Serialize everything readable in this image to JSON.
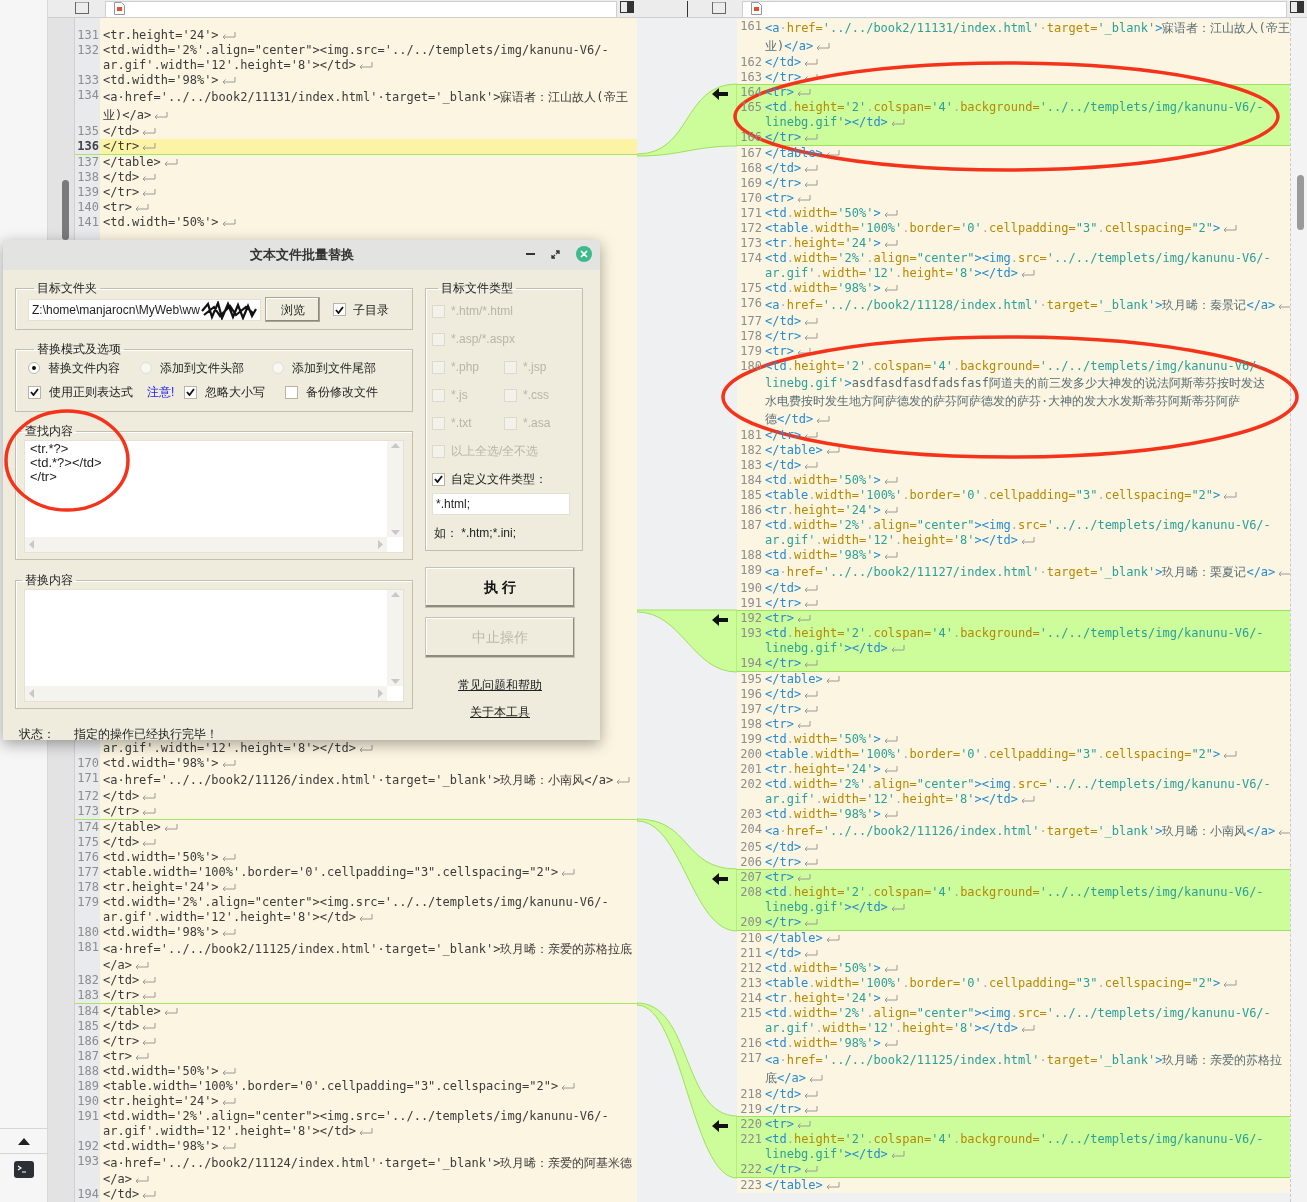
{
  "left_pane": {
    "lines_above_dialog": [
      {
        "number": "131",
        "rows": [
          "<tr.height='24'>"
        ],
        "current": false,
        "chunk_edge": false
      },
      {
        "number": "132",
        "rows": [
          "<td.width='2%'.align=\"center\"><img.src='../../templets/img/kanunu-V6/-",
          "ar.gif'.width='12'.height='8'></td>"
        ],
        "current": false,
        "chunk_edge": false
      },
      {
        "number": "133",
        "rows": [
          "<td.width='98%'>"
        ],
        "current": false,
        "chunk_edge": false
      },
      {
        "number": "134",
        "rows": [
          "<a·href='../../book2/11131/index.html'·target='_blank'>寐语者：江山故人(帝王",
          "业)</a>"
        ],
        "current": false,
        "chunk_edge": false
      },
      {
        "number": "135",
        "rows": [
          "</td>"
        ],
        "current": false,
        "chunk_edge": false
      },
      {
        "number": "136",
        "rows": [
          "</tr>"
        ],
        "current": true,
        "chunk_edge": true
      },
      {
        "number": "137",
        "rows": [
          "</table>"
        ],
        "current": false,
        "chunk_edge": false
      },
      {
        "number": "138",
        "rows": [
          "</td>"
        ],
        "current": false,
        "chunk_edge": false
      },
      {
        "number": "139",
        "rows": [
          "</tr>"
        ],
        "current": false,
        "chunk_edge": false
      },
      {
        "number": "140",
        "rows": [
          "<tr>"
        ],
        "current": false,
        "chunk_edge": false
      },
      {
        "number": "141",
        "rows": [
          "<td.width='50%'>"
        ],
        "current": false,
        "chunk_edge": false
      }
    ],
    "lines_below_dialog": [
      {
        "rows": [
          "ar.gif'.width='12'.height='8'></td>"
        ],
        "current": false,
        "chunk_edge": false
      },
      {
        "number": "170",
        "rows": [
          "<td.width='98%'>"
        ],
        "current": false,
        "chunk_edge": false
      },
      {
        "number": "171",
        "rows": [
          "<a·href='../../book2/11126/index.html'·target='_blank'>玖月晞：小南风</a>"
        ],
        "current": false,
        "chunk_edge": false
      },
      {
        "number": "172",
        "rows": [
          "</td>"
        ],
        "current": false,
        "chunk_edge": false
      },
      {
        "number": "173",
        "rows": [
          "</tr>"
        ],
        "current": false,
        "chunk_edge": true
      },
      {
        "number": "174",
        "rows": [
          "</table>"
        ],
        "current": false,
        "chunk_edge": false
      },
      {
        "number": "175",
        "rows": [
          "</td>"
        ],
        "current": false,
        "chunk_edge": false
      },
      {
        "number": "176",
        "rows": [
          "<td.width='50%'>"
        ],
        "current": false,
        "chunk_edge": false
      },
      {
        "number": "177",
        "rows": [
          "<table.width='100%'.border='0'.cellpadding=\"3\".cellspacing=\"2\">"
        ],
        "current": false,
        "chunk_edge": false
      },
      {
        "number": "178",
        "rows": [
          "<tr.height='24'>"
        ],
        "current": false,
        "chunk_edge": false
      },
      {
        "number": "179",
        "rows": [
          "<td.width='2%'.align=\"center\"><img.src='../../templets/img/kanunu-V6/-",
          "ar.gif'.width='12'.height='8'></td>"
        ],
        "current": false,
        "chunk_edge": false
      },
      {
        "number": "180",
        "rows": [
          "<td.width='98%'>"
        ],
        "current": false,
        "chunk_edge": false
      },
      {
        "number": "181",
        "rows": [
          "<a·href='../../book2/11125/index.html'·target='_blank'>玖月晞：亲爱的苏格拉底",
          "</a>"
        ],
        "current": false,
        "chunk_edge": false
      },
      {
        "number": "182",
        "rows": [
          "</td>"
        ],
        "current": false,
        "chunk_edge": false
      },
      {
        "number": "183",
        "rows": [
          "</tr>"
        ],
        "current": false,
        "chunk_edge": true
      },
      {
        "number": "184",
        "rows": [
          "</table>"
        ],
        "current": false,
        "chunk_edge": false
      },
      {
        "number": "185",
        "rows": [
          "</td>"
        ],
        "current": false,
        "chunk_edge": false
      },
      {
        "number": "186",
        "rows": [
          "</tr>"
        ],
        "current": false,
        "chunk_edge": false
      },
      {
        "number": "187",
        "rows": [
          "<tr>"
        ],
        "current": false,
        "chunk_edge": false
      },
      {
        "number": "188",
        "rows": [
          "<td.width='50%'>"
        ],
        "current": false,
        "chunk_edge": false
      },
      {
        "number": "189",
        "rows": [
          "<table.width='100%'.border='0'.cellpadding=\"3\".cellspacing=\"2\">"
        ],
        "current": false,
        "chunk_edge": false
      },
      {
        "number": "190",
        "rows": [
          "<tr.height='24'>"
        ],
        "current": false,
        "chunk_edge": false
      },
      {
        "number": "191",
        "rows": [
          "<td.width='2%'.align=\"center\"><img.src='../../templets/img/kanunu-V6/-",
          "ar.gif'.width='12'.height='8'></td>"
        ],
        "current": false,
        "chunk_edge": false
      },
      {
        "number": "192",
        "rows": [
          "<td.width='98%'>"
        ],
        "current": false,
        "chunk_edge": false
      },
      {
        "number": "193",
        "rows": [
          "<a·href='../../book2/11124/index.html'·target='_blank'>玖月晞：亲爱的阿基米德",
          "</a>"
        ],
        "current": false,
        "chunk_edge": false
      },
      {
        "number": "194",
        "rows": [
          "</td>"
        ],
        "current": false,
        "chunk_edge": false
      }
    ]
  },
  "right_pane": {
    "lines": [
      {
        "number": "161",
        "rows": [
          "<a·href='../../book2/11131/index.html'·target='_blank'>寐语者：江山故人(帝王",
          "业)</a>"
        ],
        "changed": false
      },
      {
        "number": "162",
        "rows": [
          "</td>"
        ],
        "changed": false
      },
      {
        "number": "163",
        "rows": [
          "</tr>"
        ],
        "changed": false
      },
      {
        "number": "164",
        "rows": [
          "<tr>"
        ],
        "changed": true
      },
      {
        "number": "165",
        "rows": [
          "<td.height='2'.colspan='4'.background='../../templets/img/kanunu-V6/-",
          "linebg.gif'></td>"
        ],
        "changed": true
      },
      {
        "number": "166",
        "rows": [
          "</tr>"
        ],
        "changed": true
      },
      {
        "number": "167",
        "rows": [
          "</table>"
        ],
        "changed": false
      },
      {
        "number": "168",
        "rows": [
          "</td>"
        ],
        "changed": false
      },
      {
        "number": "169",
        "rows": [
          "</tr>"
        ],
        "changed": false
      },
      {
        "number": "170",
        "rows": [
          "<tr>"
        ],
        "changed": false
      },
      {
        "number": "171",
        "rows": [
          "<td.width='50%'>"
        ],
        "changed": false
      },
      {
        "number": "172",
        "rows": [
          "<table.width='100%'.border='0'.cellpadding=\"3\".cellspacing=\"2\">"
        ],
        "changed": false
      },
      {
        "number": "173",
        "rows": [
          "<tr.height='24'>"
        ],
        "changed": false
      },
      {
        "number": "174",
        "rows": [
          "<td.width='2%'.align=\"center\"><img.src='../../templets/img/kanunu-V6/-",
          "ar.gif'.width='12'.height='8'></td>"
        ],
        "changed": false
      },
      {
        "number": "175",
        "rows": [
          "<td.width='98%'>"
        ],
        "changed": false
      },
      {
        "number": "176",
        "rows": [
          "<a·href='../../book2/11128/index.html'·target='_blank'>玖月晞：秦景记</a>"
        ],
        "changed": false
      },
      {
        "number": "177",
        "rows": [
          "</td>"
        ],
        "changed": false
      },
      {
        "number": "178",
        "rows": [
          "</tr>"
        ],
        "changed": false
      },
      {
        "number": "179",
        "rows": [
          "<tr>"
        ],
        "changed": false
      },
      {
        "number": "180",
        "rows": [
          "<td.height='2'.colspan='4'.background='../../templets/img/kanunu-V6/-",
          "linebg.gif'>asdfasdfasdfadsfasf阿道夫的前三发多少大神发的说法阿斯蒂芬按时发达",
          "水电费按时发生地方阿萨德发的萨芬阿萨德发的萨芬·大神的发大水发斯蒂芬阿斯蒂芬阿萨",
          "德</td>"
        ],
        "changed": false
      },
      {
        "number": "181",
        "rows": [
          "</tr>"
        ],
        "changed": false
      },
      {
        "number": "182",
        "rows": [
          "</table>"
        ],
        "changed": false
      },
      {
        "number": "183",
        "rows": [
          "</td>"
        ],
        "changed": false
      },
      {
        "number": "184",
        "rows": [
          "<td.width='50%'>"
        ],
        "changed": false
      },
      {
        "number": "185",
        "rows": [
          "<table.width='100%'.border='0'.cellpadding=\"3\".cellspacing=\"2\">"
        ],
        "changed": false
      },
      {
        "number": "186",
        "rows": [
          "<tr.height='24'>"
        ],
        "changed": false
      },
      {
        "number": "187",
        "rows": [
          "<td.width='2%'.align=\"center\"><img.src='../../templets/img/kanunu-V6/-",
          "ar.gif'.width='12'.height='8'></td>"
        ],
        "changed": false
      },
      {
        "number": "188",
        "rows": [
          "<td.width='98%'>"
        ],
        "changed": false
      },
      {
        "number": "189",
        "rows": [
          "<a·href='../../book2/11127/index.html'·target='_blank'>玖月晞：栗夏记</a>"
        ],
        "changed": false
      },
      {
        "number": "190",
        "rows": [
          "</td>"
        ],
        "changed": false
      },
      {
        "number": "191",
        "rows": [
          "</tr>"
        ],
        "changed": false
      },
      {
        "number": "192",
        "rows": [
          "<tr>"
        ],
        "changed": true
      },
      {
        "number": "193",
        "rows": [
          "<td.height='2'.colspan='4'.background='../../templets/img/kanunu-V6/-",
          "linebg.gif'></td>"
        ],
        "changed": true
      },
      {
        "number": "194",
        "rows": [
          "</tr>"
        ],
        "changed": true
      },
      {
        "number": "195",
        "rows": [
          "</table>"
        ],
        "changed": false
      },
      {
        "number": "196",
        "rows": [
          "</td>"
        ],
        "changed": false
      },
      {
        "number": "197",
        "rows": [
          "</tr>"
        ],
        "changed": false
      },
      {
        "number": "198",
        "rows": [
          "<tr>"
        ],
        "changed": false
      },
      {
        "number": "199",
        "rows": [
          "<td.width='50%'>"
        ],
        "changed": false
      },
      {
        "number": "200",
        "rows": [
          "<table.width='100%'.border='0'.cellpadding=\"3\".cellspacing=\"2\">"
        ],
        "changed": false
      },
      {
        "number": "201",
        "rows": [
          "<tr.height='24'>"
        ],
        "changed": false
      },
      {
        "number": "202",
        "rows": [
          "<td.width='2%'.align=\"center\"><img.src='../../templets/img/kanunu-V6/-",
          "ar.gif'.width='12'.height='8'></td>"
        ],
        "changed": false
      },
      {
        "number": "203",
        "rows": [
          "<td.width='98%'>"
        ],
        "changed": false
      },
      {
        "number": "204",
        "rows": [
          "<a·href='../../book2/11126/index.html'·target='_blank'>玖月晞：小南风</a>"
        ],
        "changed": false
      },
      {
        "number": "205",
        "rows": [
          "</td>"
        ],
        "changed": false
      },
      {
        "number": "206",
        "rows": [
          "</tr>"
        ],
        "changed": false
      },
      {
        "number": "207",
        "rows": [
          "<tr>"
        ],
        "changed": true
      },
      {
        "number": "208",
        "rows": [
          "<td.height='2'.colspan='4'.background='../../templets/img/kanunu-V6/-",
          "linebg.gif'></td>"
        ],
        "changed": true
      },
      {
        "number": "209",
        "rows": [
          "</tr>"
        ],
        "changed": true
      },
      {
        "number": "210",
        "rows": [
          "</table>"
        ],
        "changed": false
      },
      {
        "number": "211",
        "rows": [
          "</td>"
        ],
        "changed": false
      },
      {
        "number": "212",
        "rows": [
          "<td.width='50%'>"
        ],
        "changed": false
      },
      {
        "number": "213",
        "rows": [
          "<table.width='100%'.border='0'.cellpadding=\"3\".cellspacing=\"2\">"
        ],
        "changed": false
      },
      {
        "number": "214",
        "rows": [
          "<tr.height='24'>"
        ],
        "changed": false
      },
      {
        "number": "215",
        "rows": [
          "<td.width='2%'.align=\"center\"><img.src='../../templets/img/kanunu-V6/-",
          "ar.gif'.width='12'.height='8'></td>"
        ],
        "changed": false
      },
      {
        "number": "216",
        "rows": [
          "<td.width='98%'>"
        ],
        "changed": false
      },
      {
        "number": "217",
        "rows": [
          "<a·href='../../book2/11125/index.html'·target='_blank'>玖月晞：亲爱的苏格拉",
          "底</a>"
        ],
        "changed": false
      },
      {
        "number": "218",
        "rows": [
          "</td>"
        ],
        "changed": false
      },
      {
        "number": "219",
        "rows": [
          "</tr>"
        ],
        "changed": false
      },
      {
        "number": "220",
        "rows": [
          "<tr>"
        ],
        "changed": true
      },
      {
        "number": "221",
        "rows": [
          "<td.height='2'.colspan='4'.background='../../templets/img/kanunu-V6/-",
          "linebg.gif'></td>"
        ],
        "changed": true
      },
      {
        "number": "222",
        "rows": [
          "</tr>"
        ],
        "changed": true
      },
      {
        "number": "223",
        "rows": [
          "</table>"
        ],
        "changed": false
      }
    ]
  },
  "dialog": {
    "title": "文本文件批量替换",
    "folder_group": {
      "legend": "目标文件夹",
      "path": "Z:\\home\\manjarocn\\MyWeb\\ww",
      "browse": "浏览",
      "subdir": {
        "label": "子目录",
        "checked": true
      }
    },
    "mode_group": {
      "legend": "替换模式及选项",
      "modes": [
        {
          "label": "替换文件内容",
          "selected": true
        },
        {
          "label": "添加到文件头部",
          "selected": false
        },
        {
          "label": "添加到文件尾部",
          "selected": false
        }
      ],
      "options": [
        {
          "kind": "checkbox",
          "label": "使用正则表达式",
          "checked": true
        },
        {
          "kind": "link",
          "label": "注意!"
        },
        {
          "kind": "checkbox",
          "label": "忽略大小写",
          "checked": true
        },
        {
          "kind": "checkbox",
          "label": "备份修改文件",
          "checked": false
        }
      ]
    },
    "find_group": {
      "legend": "查找内容",
      "value": "<tr.*?>\n<td.*?></td>\n</tr>"
    },
    "replace_group": {
      "legend": "替换内容"
    },
    "types_group": {
      "legend": "目标文件类型",
      "rows": [
        [
          {
            "label": "*.htm/*.html",
            "checked": false,
            "disabled": true
          }
        ],
        [
          {
            "label": "*.asp/*.aspx",
            "checked": false,
            "disabled": true
          }
        ],
        [
          {
            "label": "*.php",
            "checked": false,
            "disabled": true
          },
          {
            "label": "*.jsp",
            "checked": false,
            "disabled": true
          }
        ],
        [
          {
            "label": "*.js",
            "checked": false,
            "disabled": true
          },
          {
            "label": "*.css",
            "checked": false,
            "disabled": true
          }
        ],
        [
          {
            "label": "*.txt",
            "checked": false,
            "disabled": true
          },
          {
            "label": "*.asa",
            "checked": false,
            "disabled": true
          }
        ],
        [
          {
            "label": "以上全选/全不选",
            "checked": false,
            "disabled": true
          }
        ]
      ],
      "custom": {
        "label": "自定义文件类型：",
        "checked": true
      },
      "custom_value": "*.html;",
      "hint": "如： *.htm;*.ini;"
    },
    "run_button": {
      "label": "执 行",
      "disabled": false
    },
    "stop_button": {
      "label": "中止操作",
      "disabled": true
    },
    "links": [
      "常见问题和帮助",
      "关于本工具"
    ],
    "status_label": "状态：",
    "status": "指定的操作已经执行完毕！"
  }
}
